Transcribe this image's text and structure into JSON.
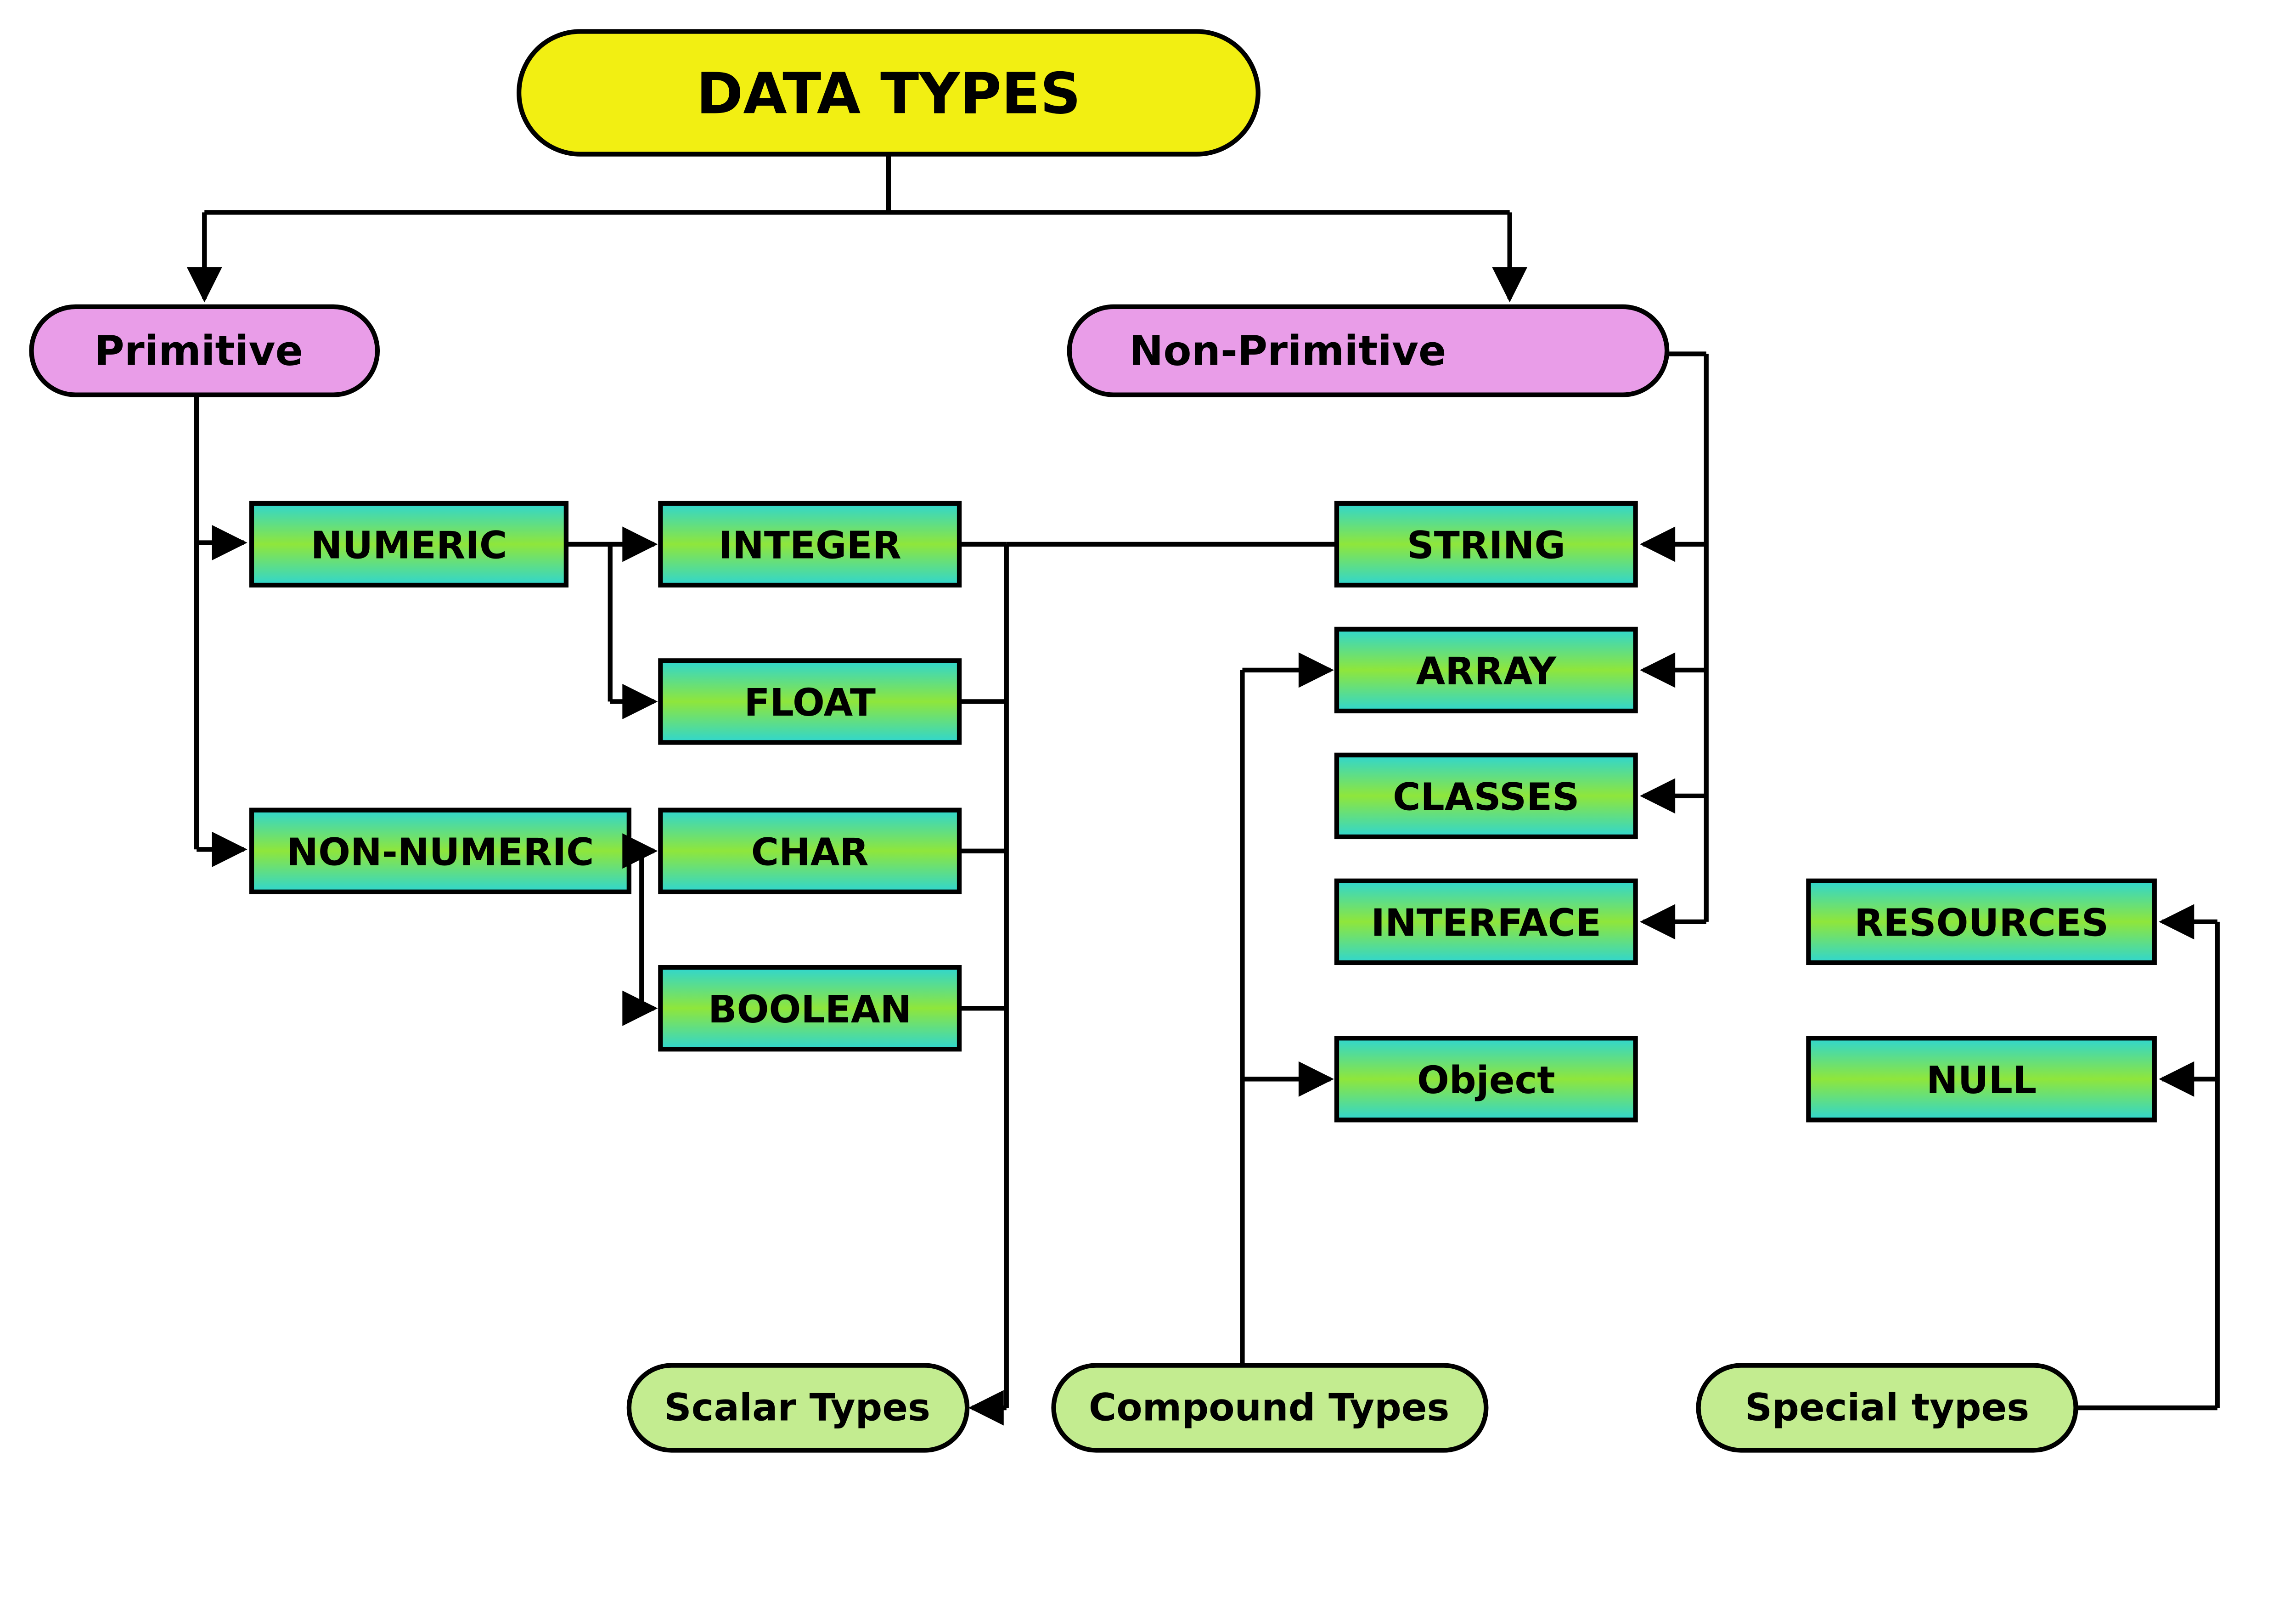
{
  "root": {
    "label": "DATA TYPES"
  },
  "categories": {
    "primitive": {
      "label": "Primitive"
    },
    "non_primitive": {
      "label": "Non-Primitive"
    }
  },
  "primitive_groups": {
    "numeric": {
      "label": "NUMERIC"
    },
    "non_numeric": {
      "label": "NON-NUMERIC"
    }
  },
  "primitive_leaves": {
    "integer": {
      "label": "INTEGER"
    },
    "float": {
      "label": "FLOAT"
    },
    "char": {
      "label": "CHAR"
    },
    "boolean": {
      "label": "BOOLEAN"
    }
  },
  "non_primitive_leaves": {
    "string": {
      "label": "STRING"
    },
    "array": {
      "label": "ARRAY"
    },
    "classes": {
      "label": "CLASSES"
    },
    "interface": {
      "label": "INTERFACE"
    },
    "object": {
      "label": "Object"
    }
  },
  "special_leaves": {
    "resources": {
      "label": "RESOURCES"
    },
    "null": {
      "label": "NULL"
    }
  },
  "legends": {
    "scalar": {
      "label": "Scalar Types"
    },
    "compound": {
      "label": "Compound Types"
    },
    "special": {
      "label": "Special types"
    }
  },
  "colors": {
    "root_fill": "#f2ef12",
    "category_fill": "#e99de8",
    "legend_fill": "#c3ec90",
    "box_grad_outer": "#2fd6d0",
    "box_grad_inner": "#8fe63b",
    "stroke": "#000000"
  }
}
